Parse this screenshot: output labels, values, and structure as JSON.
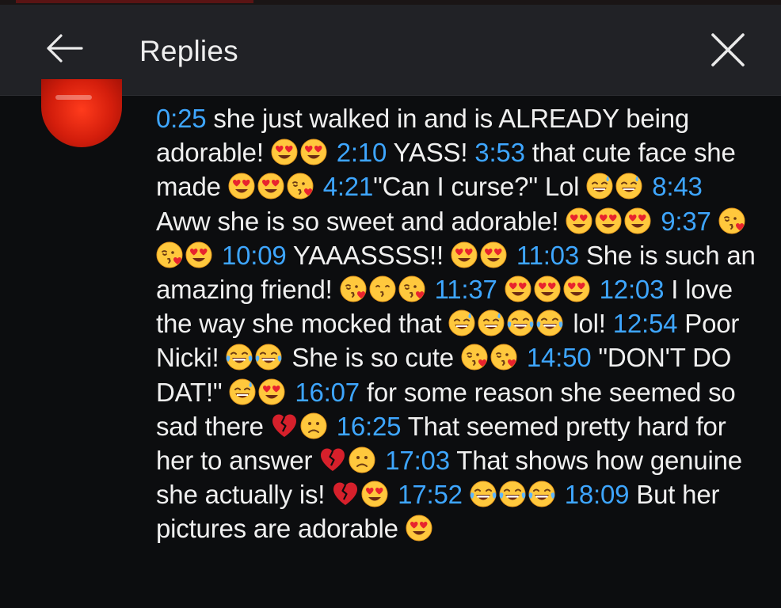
{
  "header": {
    "title": "Replies",
    "back_icon": "arrow-left-icon",
    "close_icon": "close-icon"
  },
  "avatar": {
    "color": "#e0230f"
  },
  "colors": {
    "timestamp": "#3ea6ff",
    "text": "#f0f0f0",
    "header_bg": "#212226",
    "page_bg": "#0c0d0f"
  },
  "comment": {
    "segments": [
      {
        "type": "ts",
        "text": "0:25"
      },
      {
        "type": "text",
        "text": " she just walked in and is ALREADY being adorable! "
      },
      {
        "type": "emoji",
        "name": "heart-eyes"
      },
      {
        "type": "emoji",
        "name": "heart-eyes"
      },
      {
        "type": "text",
        "text": " "
      },
      {
        "type": "ts",
        "text": "2:10"
      },
      {
        "type": "text",
        "text": " YASS! "
      },
      {
        "type": "ts",
        "text": "3:53"
      },
      {
        "type": "text",
        "text": " that cute face she made "
      },
      {
        "type": "emoji",
        "name": "heart-eyes"
      },
      {
        "type": "emoji",
        "name": "heart-eyes"
      },
      {
        "type": "emoji",
        "name": "kissing-heart"
      },
      {
        "type": "text",
        "text": " "
      },
      {
        "type": "ts",
        "text": "4:21"
      },
      {
        "type": "text",
        "text": "\"Can I curse?\" Lol "
      },
      {
        "type": "emoji",
        "name": "sweat-smile"
      },
      {
        "type": "emoji",
        "name": "sweat-smile"
      },
      {
        "type": "text",
        "text": " "
      },
      {
        "type": "ts",
        "text": "8:43"
      },
      {
        "type": "text",
        "text": " Aww she is so sweet and adorable! "
      },
      {
        "type": "emoji",
        "name": "heart-eyes"
      },
      {
        "type": "emoji",
        "name": "heart-eyes"
      },
      {
        "type": "emoji",
        "name": "heart-eyes"
      },
      {
        "type": "text",
        "text": " "
      },
      {
        "type": "ts",
        "text": "9:37"
      },
      {
        "type": "text",
        "text": " "
      },
      {
        "type": "emoji",
        "name": "kissing-heart"
      },
      {
        "type": "emoji",
        "name": "kissing-heart"
      },
      {
        "type": "emoji",
        "name": "heart-eyes"
      },
      {
        "type": "text",
        "text": " "
      },
      {
        "type": "ts",
        "text": "10:09"
      },
      {
        "type": "text",
        "text": " YAAASSSS!! "
      },
      {
        "type": "emoji",
        "name": "heart-eyes"
      },
      {
        "type": "emoji",
        "name": "heart-eyes"
      },
      {
        "type": "text",
        "text": " "
      },
      {
        "type": "ts",
        "text": "11:03"
      },
      {
        "type": "text",
        "text": " She is such an amazing friend! "
      },
      {
        "type": "emoji",
        "name": "kissing-heart"
      },
      {
        "type": "emoji",
        "name": "kissing"
      },
      {
        "type": "emoji",
        "name": "kissing-heart"
      },
      {
        "type": "text",
        "text": " "
      },
      {
        "type": "ts",
        "text": "11:37"
      },
      {
        "type": "text",
        "text": " "
      },
      {
        "type": "emoji",
        "name": "heart-eyes"
      },
      {
        "type": "emoji",
        "name": "heart-eyes"
      },
      {
        "type": "emoji",
        "name": "heart-eyes"
      },
      {
        "type": "text",
        "text": " "
      },
      {
        "type": "ts",
        "text": "12:03"
      },
      {
        "type": "text",
        "text": " I love the way she mocked that "
      },
      {
        "type": "emoji",
        "name": "sweat-smile"
      },
      {
        "type": "emoji",
        "name": "sweat-smile"
      },
      {
        "type": "emoji",
        "name": "joy"
      },
      {
        "type": "emoji",
        "name": "joy"
      },
      {
        "type": "text",
        "text": " lol! "
      },
      {
        "type": "ts",
        "text": "12:54"
      },
      {
        "type": "text",
        "text": " Poor Nicki! "
      },
      {
        "type": "emoji",
        "name": "joy"
      },
      {
        "type": "emoji",
        "name": "joy"
      },
      {
        "type": "text",
        "text": " She is so cute "
      },
      {
        "type": "emoji",
        "name": "kissing-heart"
      },
      {
        "type": "emoji",
        "name": "kissing-heart"
      },
      {
        "type": "text",
        "text": " "
      },
      {
        "type": "ts",
        "text": "14:50"
      },
      {
        "type": "text",
        "text": " \"DON'T DO DAT!\" "
      },
      {
        "type": "emoji",
        "name": "sweat-smile"
      },
      {
        "type": "emoji",
        "name": "heart-eyes"
      },
      {
        "type": "text",
        "text": " "
      },
      {
        "type": "ts",
        "text": "16:07"
      },
      {
        "type": "text",
        "text": " for some reason she seemed so sad there "
      },
      {
        "type": "emoji",
        "name": "broken-heart"
      },
      {
        "type": "emoji",
        "name": "sad"
      },
      {
        "type": "text",
        "text": " "
      },
      {
        "type": "ts",
        "text": "16:25"
      },
      {
        "type": "text",
        "text": " That seemed pretty hard for her to answer "
      },
      {
        "type": "emoji",
        "name": "broken-heart"
      },
      {
        "type": "emoji",
        "name": "sad"
      },
      {
        "type": "text",
        "text": " "
      },
      {
        "type": "ts",
        "text": "17:03"
      },
      {
        "type": "text",
        "text": " That shows how genuine she actually is! "
      },
      {
        "type": "emoji",
        "name": "broken-heart"
      },
      {
        "type": "emoji",
        "name": "heart-eyes"
      },
      {
        "type": "text",
        "text": " "
      },
      {
        "type": "ts",
        "text": "17:52"
      },
      {
        "type": "text",
        "text": " "
      },
      {
        "type": "emoji",
        "name": "joy"
      },
      {
        "type": "emoji",
        "name": "joy"
      },
      {
        "type": "emoji",
        "name": "joy"
      },
      {
        "type": "text",
        "text": " "
      },
      {
        "type": "ts",
        "text": "18:09"
      },
      {
        "type": "text",
        "text": " But her pictures are adorable "
      },
      {
        "type": "emoji",
        "name": "heart-eyes"
      }
    ]
  }
}
